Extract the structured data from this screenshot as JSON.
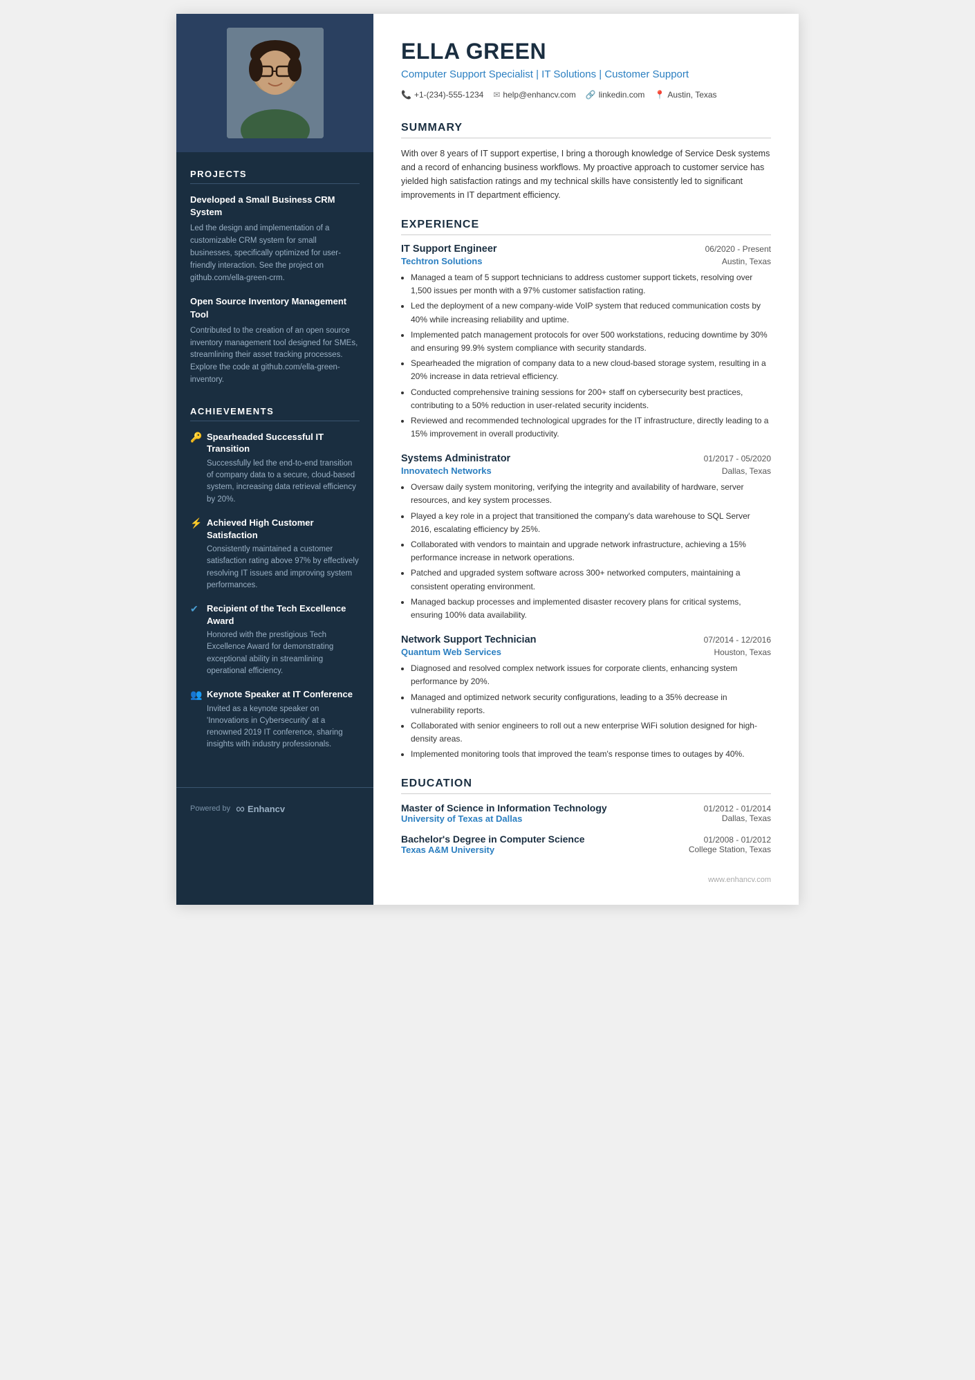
{
  "person": {
    "name": "ELLA GREEN",
    "title": "Computer Support Specialist | IT Solutions | Customer Support",
    "photo_alt": "Ella Green headshot"
  },
  "contact": {
    "phone": "+1-(234)-555-1234",
    "email": "help@enhancv.com",
    "linkedin": "linkedin.com",
    "location": "Austin, Texas",
    "phone_icon": "📞",
    "email_icon": "✉",
    "linkedin_icon": "🔗",
    "location_icon": "📍"
  },
  "summary": {
    "section_title": "SUMMARY",
    "text": "With over 8 years of IT support expertise, I bring a thorough knowledge of Service Desk systems and a record of enhancing business workflows. My proactive approach to customer service has yielded high satisfaction ratings and my technical skills have consistently led to significant improvements in IT department efficiency."
  },
  "projects": {
    "section_title": "PROJECTS",
    "items": [
      {
        "title": "Developed a Small Business CRM System",
        "description": "Led the design and implementation of a customizable CRM system for small businesses, specifically optimized for user-friendly interaction. See the project on github.com/ella-green-crm."
      },
      {
        "title": "Open Source Inventory Management Tool",
        "description": "Contributed to the creation of an open source inventory management tool designed for SMEs, streamlining their asset tracking processes. Explore the code at github.com/ella-green-inventory."
      }
    ]
  },
  "achievements": {
    "section_title": "ACHIEVEMENTS",
    "items": [
      {
        "icon": "🔑",
        "icon_name": "key-icon",
        "title": "Spearheaded Successful IT Transition",
        "description": "Successfully led the end-to-end transition of company data to a secure, cloud-based system, increasing data retrieval efficiency by 20%."
      },
      {
        "icon": "⚡",
        "icon_name": "lightning-icon",
        "title": "Achieved High Customer Satisfaction",
        "description": "Consistently maintained a customer satisfaction rating above 97% by effectively resolving IT issues and improving system performances."
      },
      {
        "icon": "✔",
        "icon_name": "check-icon",
        "title": "Recipient of the Tech Excellence Award",
        "description": "Honored with the prestigious Tech Excellence Award for demonstrating exceptional ability in streamlining operational efficiency."
      },
      {
        "icon": "👤",
        "icon_name": "person-icon",
        "title": "Keynote Speaker at IT Conference",
        "description": "Invited as a keynote speaker on 'Innovations in Cybersecurity' at a renowned 2019 IT conference, sharing insights with industry professionals."
      }
    ]
  },
  "experience": {
    "section_title": "EXPERIENCE",
    "items": [
      {
        "role": "IT Support Engineer",
        "dates": "06/2020 - Present",
        "company": "Techtron Solutions",
        "location": "Austin, Texas",
        "bullets": [
          "Managed a team of 5 support technicians to address customer support tickets, resolving over 1,500 issues per month with a 97% customer satisfaction rating.",
          "Led the deployment of a new company-wide VoIP system that reduced communication costs by 40% while increasing reliability and uptime.",
          "Implemented patch management protocols for over 500 workstations, reducing downtime by 30% and ensuring 99.9% system compliance with security standards.",
          "Spearheaded the migration of company data to a new cloud-based storage system, resulting in a 20% increase in data retrieval efficiency.",
          "Conducted comprehensive training sessions for 200+ staff on cybersecurity best practices, contributing to a 50% reduction in user-related security incidents.",
          "Reviewed and recommended technological upgrades for the IT infrastructure, directly leading to a 15% improvement in overall productivity."
        ]
      },
      {
        "role": "Systems Administrator",
        "dates": "01/2017 - 05/2020",
        "company": "Innovatech Networks",
        "location": "Dallas, Texas",
        "bullets": [
          "Oversaw daily system monitoring, verifying the integrity and availability of hardware, server resources, and key system processes.",
          "Played a key role in a project that transitioned the company's data warehouse to SQL Server 2016, escalating efficiency by 25%.",
          "Collaborated with vendors to maintain and upgrade network infrastructure, achieving a 15% performance increase in network operations.",
          "Patched and upgraded system software across 300+ networked computers, maintaining a consistent operating environment.",
          "Managed backup processes and implemented disaster recovery plans for critical systems, ensuring 100% data availability."
        ]
      },
      {
        "role": "Network Support Technician",
        "dates": "07/2014 - 12/2016",
        "company": "Quantum Web Services",
        "location": "Houston, Texas",
        "bullets": [
          "Diagnosed and resolved complex network issues for corporate clients, enhancing system performance by 20%.",
          "Managed and optimized network security configurations, leading to a 35% decrease in vulnerability reports.",
          "Collaborated with senior engineers to roll out a new enterprise WiFi solution designed for high-density areas.",
          "Implemented monitoring tools that improved the team's response times to outages by 40%."
        ]
      }
    ]
  },
  "education": {
    "section_title": "EDUCATION",
    "items": [
      {
        "degree": "Master of Science in Information Technology",
        "dates": "01/2012 - 01/2014",
        "school": "University of Texas at Dallas",
        "location": "Dallas, Texas"
      },
      {
        "degree": "Bachelor's Degree in Computer Science",
        "dates": "01/2008 - 01/2012",
        "school": "Texas A&M University",
        "location": "College Station, Texas"
      }
    ]
  },
  "footer": {
    "powered_by": "Powered by",
    "brand": "Enhancv",
    "website": "www.enhancv.com"
  }
}
